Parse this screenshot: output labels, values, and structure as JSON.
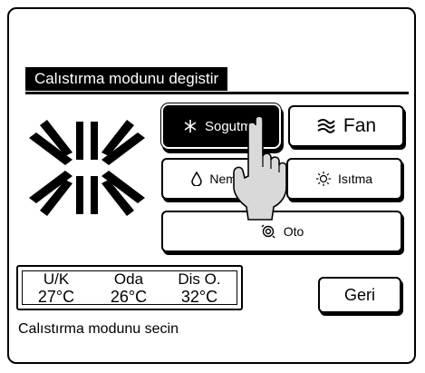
{
  "header": {
    "title": "Calıstırma modunu degistir"
  },
  "modes": {
    "cool": {
      "label": "Sogutma",
      "icon": "snowflake-icon",
      "selected": true
    },
    "fan": {
      "label": "Fan",
      "icon": "fan-icon"
    },
    "dry": {
      "label": "Nem a",
      "icon": "water-drop-icon"
    },
    "heat": {
      "label": "Isıtma",
      "icon": "sun-icon"
    },
    "auto": {
      "label": "Oto",
      "icon": "auto-cycle-icon"
    }
  },
  "current_mode_icon": "large-snowflake-icon",
  "status": {
    "set": {
      "label": "U/K",
      "value": "27°C"
    },
    "room": {
      "label": "Oda",
      "value": "26°C"
    },
    "outside": {
      "label": "Dis O.",
      "value": "32°C"
    }
  },
  "back_button": {
    "label": "Geri"
  },
  "hint": "Calıstırma modunu secin",
  "colors": {
    "foreground": "#000000",
    "background": "#ffffff"
  }
}
